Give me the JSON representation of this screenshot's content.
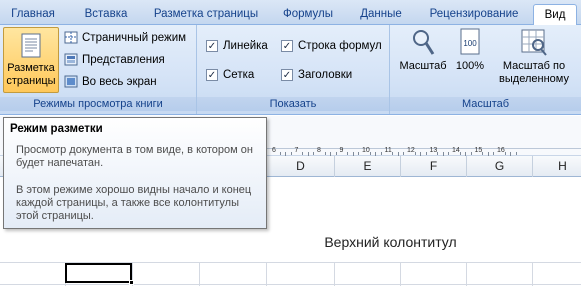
{
  "tabs": [
    "Главная",
    "Вставка",
    "Разметка страницы",
    "Формулы",
    "Данные",
    "Рецензирование",
    "Вид"
  ],
  "active_tab": "Вид",
  "ribbon": {
    "views_group": {
      "label": "Режимы просмотра книги",
      "page_layout_button": {
        "line1": "Разметка",
        "line2": "страницы",
        "icon": "page-layout-icon"
      },
      "page_break_button": {
        "label": "Страничный режим",
        "icon": "page-break-icon"
      },
      "custom_views_button": {
        "label": "Представления",
        "icon": "custom-views-icon"
      },
      "full_screen_button": {
        "label": "Во весь экран",
        "icon": "full-screen-icon"
      }
    },
    "show_group": {
      "label": "Показать",
      "ruler": {
        "label": "Линейка",
        "checked": true
      },
      "formula_bar": {
        "label": "Строка формул",
        "checked": true
      },
      "gridlines": {
        "label": "Сетка",
        "checked": true
      },
      "headings": {
        "label": "Заголовки",
        "checked": true
      }
    },
    "zoom_group": {
      "label": "Масштаб",
      "zoom_button": {
        "label": "Масштаб",
        "icon": "magnifier-icon"
      },
      "zoom100_button": {
        "label": "100%",
        "icon": "zoom-100-icon"
      },
      "zoom_selection_button": {
        "line1": "Масштаб по",
        "line2": "выделенному",
        "icon": "zoom-to-selection-icon"
      }
    }
  },
  "tooltip": {
    "title": "Режим разметки",
    "paragraph1": "Просмотр документа в том виде, в котором он будет напечатан.",
    "paragraph2": "В этом режиме хорошо видны начало и конец каждой страницы, а также все колонтитулы этой страницы."
  },
  "ruler": {
    "numbers": [
      "6",
      "7",
      "8",
      "9",
      "10",
      "11",
      "12",
      "13",
      "14",
      "15",
      "16"
    ]
  },
  "columns": [
    "D",
    "E",
    "F",
    "G",
    "H"
  ],
  "sheet": {
    "header_text": "Верхний колонтитул"
  },
  "colors": {
    "ribbon_bg": "#d6e4f7",
    "accent_border": "#8db2e3",
    "pressed": "#ffc85a",
    "text": "#15428b"
  }
}
